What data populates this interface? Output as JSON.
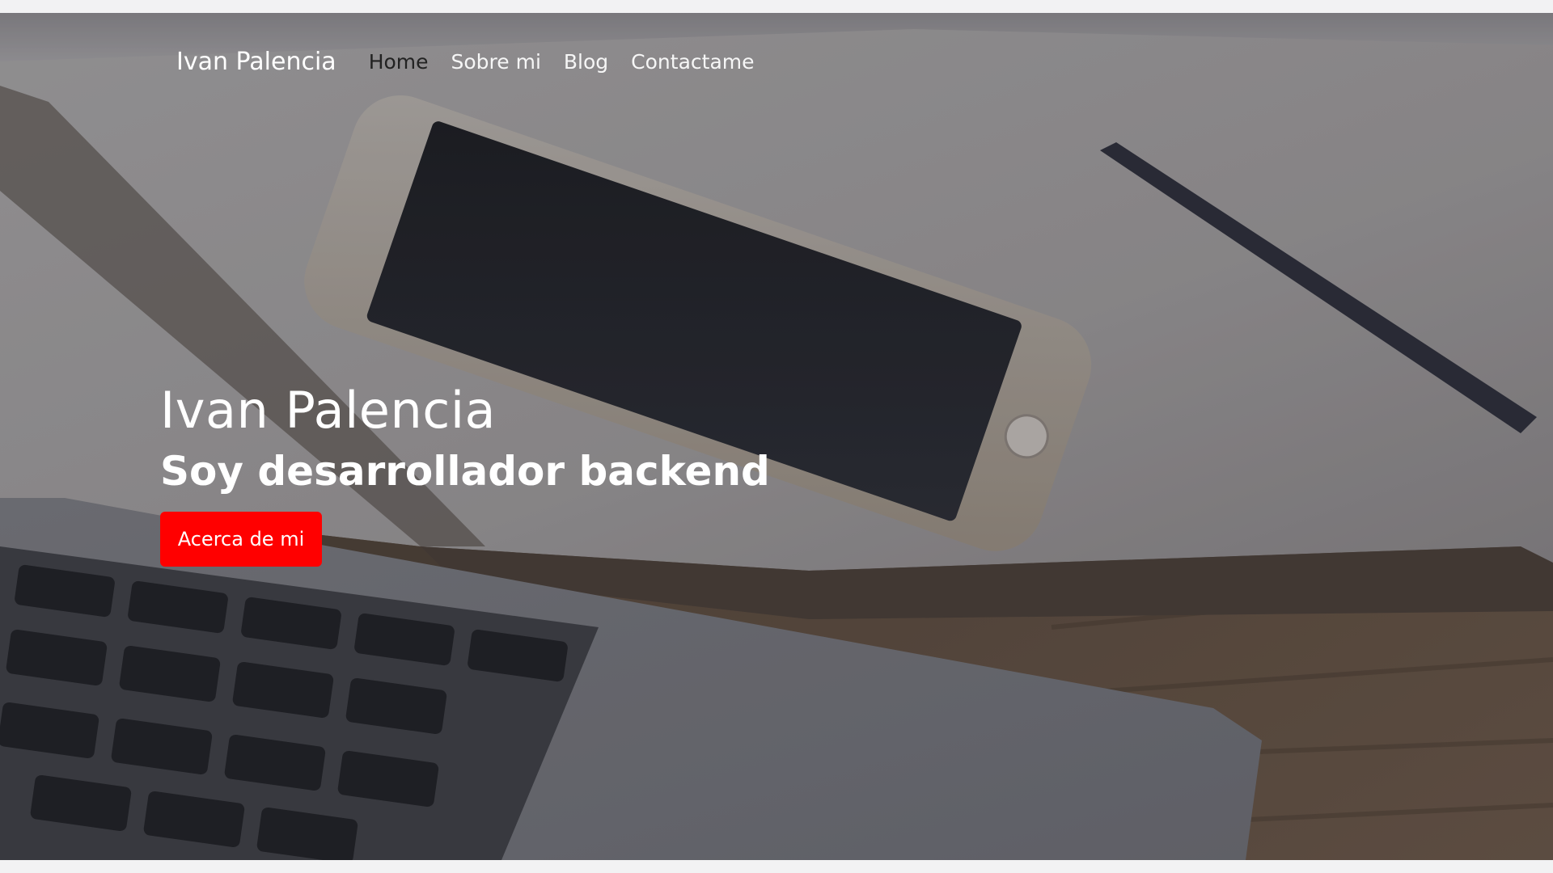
{
  "navbar": {
    "brand": "Ivan Palencia",
    "links": [
      {
        "label": "Home",
        "active": true
      },
      {
        "label": "Sobre mi",
        "active": false
      },
      {
        "label": "Blog",
        "active": false
      },
      {
        "label": "Contactame",
        "active": false
      }
    ]
  },
  "hero": {
    "title": "Ivan Palencia",
    "subtitle": "Soy desarrollador backend",
    "cta_label": "Acerca de mi",
    "background_image": "desk-with-laptop-phone-notebook-pen"
  },
  "colors": {
    "cta": "#ff0000",
    "text": "#ffffff",
    "active_nav": "#222222"
  }
}
